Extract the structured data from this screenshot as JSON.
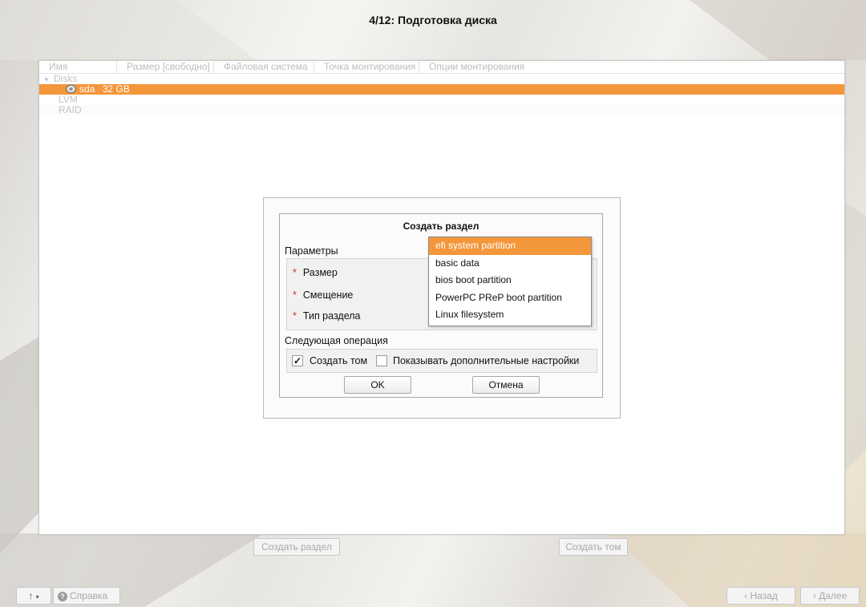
{
  "title": "4/12: Подготовка диска",
  "tree": {
    "columns": [
      "Имя",
      "Размер [свободно]",
      "Файловая система",
      "Точка монтирования",
      "Опции монтирования"
    ],
    "rows": [
      {
        "label": "Disks",
        "size": ""
      },
      {
        "label": "sda",
        "size": "32 GB"
      },
      {
        "label": "LVM",
        "size": ""
      },
      {
        "label": "RAID",
        "size": ""
      }
    ]
  },
  "dialog": {
    "title": "Создать раздел",
    "params_label": "Параметры",
    "fields": [
      "Размер",
      "Смещение",
      "Тип раздела"
    ],
    "next_op_label": "Следующая операция",
    "create_volume_label": "Создать том",
    "create_volume_checked": true,
    "show_advanced_label": "Показывать дополнительные настройки",
    "show_advanced_checked": false,
    "ok_label": "OK",
    "cancel_label": "Отмена"
  },
  "dropdown": {
    "options": [
      "efi system partition",
      "basic data",
      "bios boot partition",
      "PowerPC PReP boot partition",
      "Linux filesystem"
    ],
    "highlighted": "efi system partition"
  },
  "actions": {
    "create_partition": "Создать раздел",
    "create_volume": "Создать том"
  },
  "footer": {
    "up_label": "↑",
    "help_label": "Справка",
    "back_label": "Назад",
    "next_label": "Далее"
  },
  "icons": {
    "disk": "disk-icon",
    "expand": "triangle-down-icon",
    "help": "help-icon",
    "back": "arrow-left-icon",
    "next": "arrow-right-icon"
  },
  "colors": {
    "accent": "#f4963a",
    "required": "#d42a2a"
  }
}
